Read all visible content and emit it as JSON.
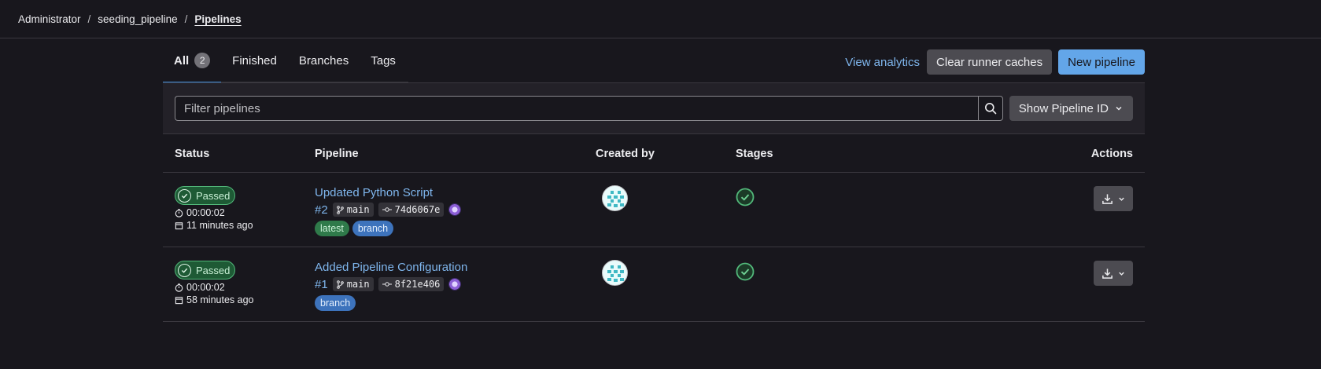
{
  "breadcrumb": {
    "items": [
      "Administrator",
      "seeding_pipeline",
      "Pipelines"
    ],
    "separator": "/"
  },
  "tabs": [
    {
      "label": "All",
      "count": "2"
    },
    {
      "label": "Finished"
    },
    {
      "label": "Branches"
    },
    {
      "label": "Tags"
    }
  ],
  "top_actions": {
    "analytics_link": "View analytics",
    "clear_cache": "Clear runner caches",
    "new_pipeline": "New pipeline"
  },
  "filter": {
    "placeholder": "Filter pipelines",
    "show_id_label": "Show Pipeline ID"
  },
  "table": {
    "headers": {
      "status": "Status",
      "pipeline": "Pipeline",
      "created_by": "Created by",
      "stages": "Stages",
      "actions": "Actions"
    },
    "rows": [
      {
        "status": "Passed",
        "duration": "00:00:02",
        "finished": "11 minutes ago",
        "title": "Updated Python Script",
        "id": "#2",
        "branch": "main",
        "commit": "74d6067e",
        "tags": [
          "latest",
          "branch"
        ]
      },
      {
        "status": "Passed",
        "duration": "00:00:02",
        "finished": "58 minutes ago",
        "title": "Added Pipeline Configuration",
        "id": "#1",
        "branch": "main",
        "commit": "8f21e406",
        "tags": [
          "branch"
        ]
      }
    ]
  },
  "colors": {
    "background": "#18171d",
    "link": "#7fb6ed",
    "primary_button": "#63a6e9",
    "success": "#52b87a"
  },
  "icons": [
    "clock-icon",
    "calendar-icon",
    "branch-icon",
    "commit-icon",
    "search-icon",
    "chevron-down-icon",
    "download-icon",
    "check-circle-icon"
  ]
}
